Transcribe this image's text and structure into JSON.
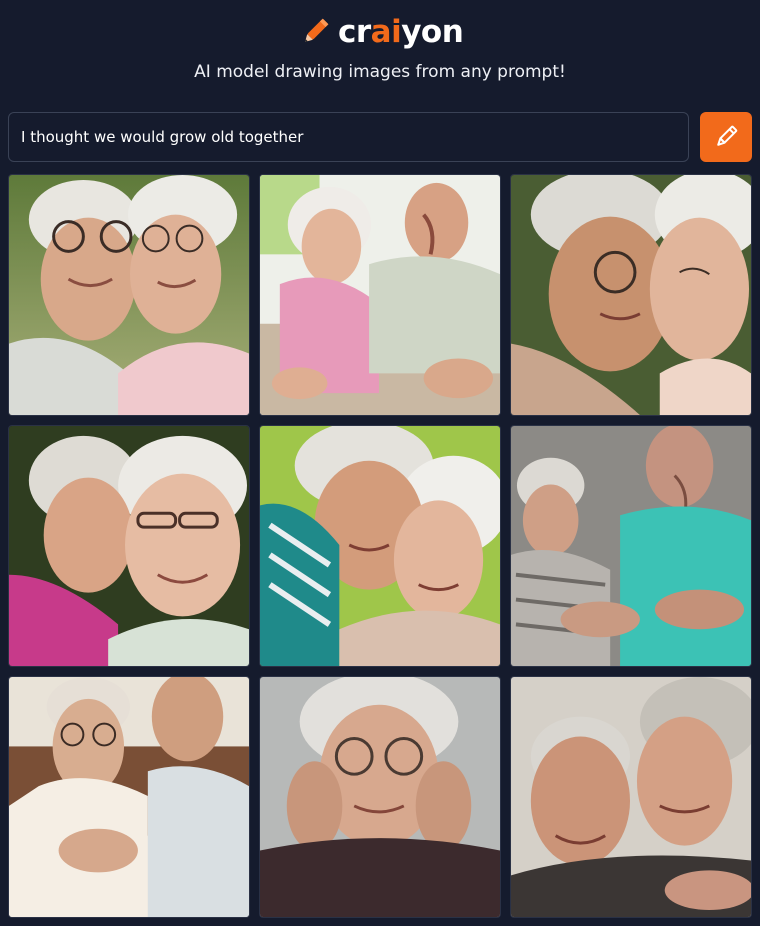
{
  "brand": {
    "name_parts": [
      "cr",
      "ai",
      "yon"
    ],
    "accent_color": "#f26a1b",
    "icon": "pencil-icon"
  },
  "tagline": "AI model drawing images from any prompt!",
  "prompt": {
    "value": "I thought we would grow old together"
  },
  "draw_button": {
    "icon": "pencil-icon"
  },
  "results": [
    {
      "name": "generated-image-1"
    },
    {
      "name": "generated-image-2"
    },
    {
      "name": "generated-image-3"
    },
    {
      "name": "generated-image-4"
    },
    {
      "name": "generated-image-5"
    },
    {
      "name": "generated-image-6"
    },
    {
      "name": "generated-image-7"
    },
    {
      "name": "generated-image-8"
    },
    {
      "name": "generated-image-9"
    }
  ]
}
